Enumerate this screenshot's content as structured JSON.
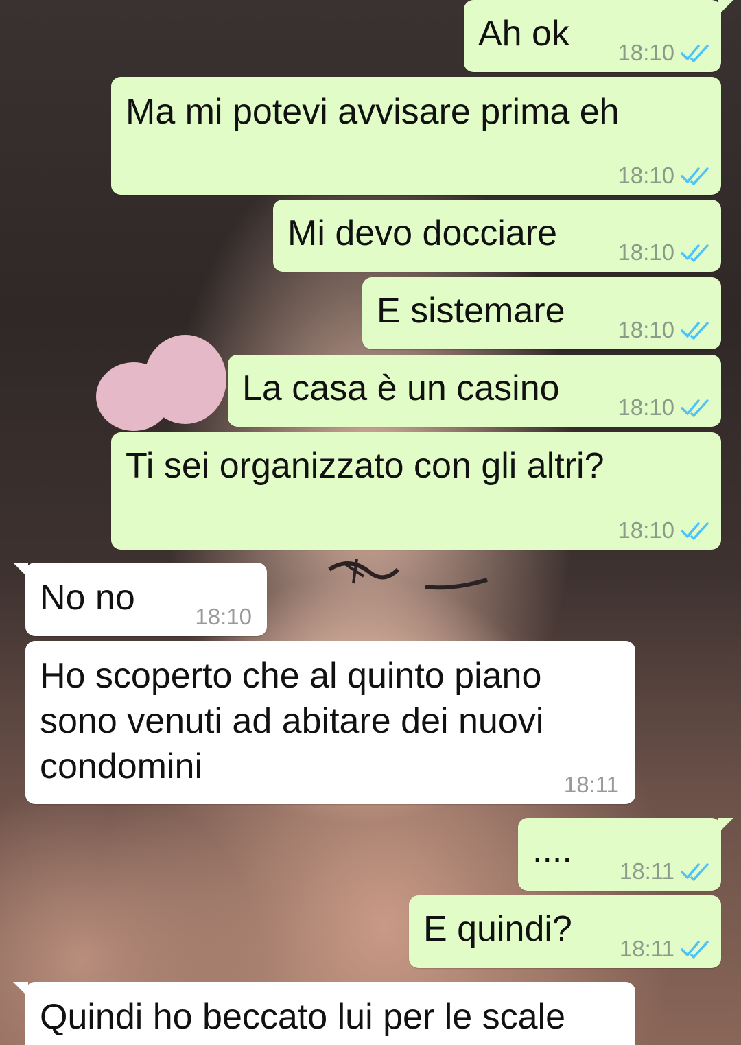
{
  "conversation": {
    "messages": [
      {
        "id": "m1",
        "direction": "outgoing",
        "text": "Ah ok",
        "time": "18:10",
        "status": "read"
      },
      {
        "id": "m2",
        "direction": "outgoing",
        "text": "Ma mi potevi avvisare prima eh",
        "time": "18:10",
        "status": "read"
      },
      {
        "id": "m3",
        "direction": "outgoing",
        "text": "Mi devo docciare",
        "time": "18:10",
        "status": "read"
      },
      {
        "id": "m4",
        "direction": "outgoing",
        "text": "E sistemare",
        "time": "18:10",
        "status": "read"
      },
      {
        "id": "m5",
        "direction": "outgoing",
        "text": "La casa è un casino",
        "time": "18:10",
        "status": "read"
      },
      {
        "id": "m6",
        "direction": "outgoing",
        "text": "Ti sei organizzato con gli altri?",
        "time": "18:10",
        "status": "read"
      },
      {
        "id": "m7",
        "direction": "incoming",
        "text": "No no",
        "time": "18:10"
      },
      {
        "id": "m8",
        "direction": "incoming",
        "text": "Ho scoperto che al quinto piano\nsono venuti ad abitare dei nuovi\ncondomini",
        "time": "18:11"
      },
      {
        "id": "m9",
        "direction": "outgoing",
        "text": "....",
        "time": "18:11",
        "status": "read"
      },
      {
        "id": "m10",
        "direction": "outgoing",
        "text": "E quindi?",
        "time": "18:11",
        "status": "read"
      },
      {
        "id": "m11",
        "direction": "incoming",
        "text": "Quindi ho beccato lui per le scale",
        "time": ""
      }
    ]
  },
  "colors": {
    "outgoing_bubble": "#e2fcc8",
    "incoming_bubble": "#ffffff",
    "read_ticks": "#4fc3f7",
    "timestamp": "#8c9a8a"
  },
  "icons": {
    "read_receipt": "double-check-icon"
  }
}
